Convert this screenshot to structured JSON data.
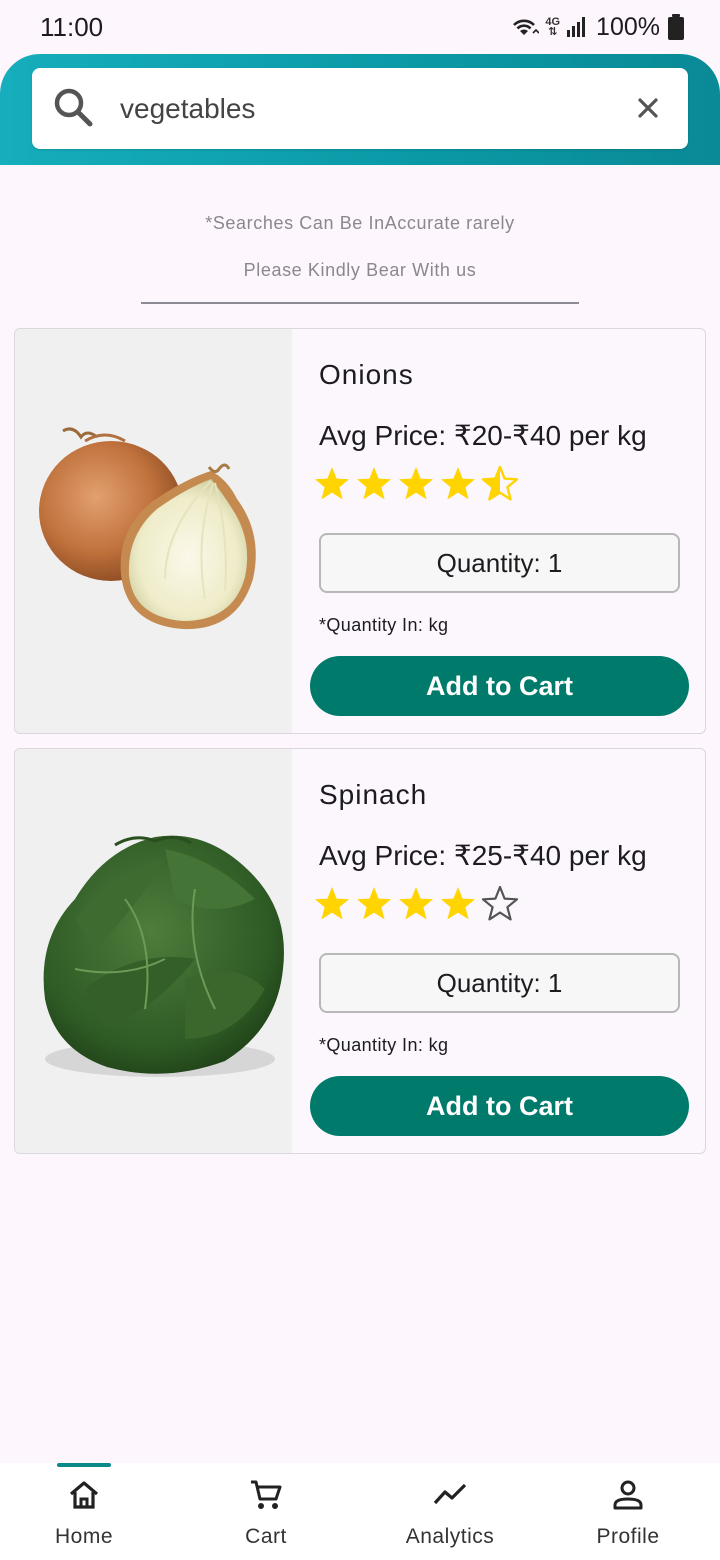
{
  "status_bar": {
    "time": "11:00",
    "battery": "100%",
    "network": "4G"
  },
  "search": {
    "query": "vegetables",
    "placeholder": ""
  },
  "notice": {
    "line1": "*Searches Can Be InAccurate rarely",
    "line2": "Please Kindly Bear With us"
  },
  "products": [
    {
      "name": "Onions",
      "price": "Avg Price: ₹20-₹40 per kg",
      "rating": 4.5,
      "quantity": "Quantity: 1",
      "quantity_note": "*Quantity In: kg",
      "button": "Add to Cart",
      "image": "onion-image"
    },
    {
      "name": "Spinach",
      "price": "Avg Price: ₹25-₹40 per kg",
      "rating": 4,
      "quantity": "Quantity: 1",
      "quantity_note": "*Quantity In: kg",
      "button": "Add to Cart",
      "image": "spinach-image"
    }
  ],
  "nav": [
    {
      "label": "Home",
      "icon": "home-icon",
      "active": true
    },
    {
      "label": "Cart",
      "icon": "cart-icon",
      "active": false
    },
    {
      "label": "Analytics",
      "icon": "analytics-icon",
      "active": false
    },
    {
      "label": "Profile",
      "icon": "profile-icon",
      "active": false
    }
  ],
  "colors": {
    "header": "#0b9aa7",
    "button": "#007a6a",
    "star": "#ffd400",
    "background": "#fdf6fc"
  }
}
